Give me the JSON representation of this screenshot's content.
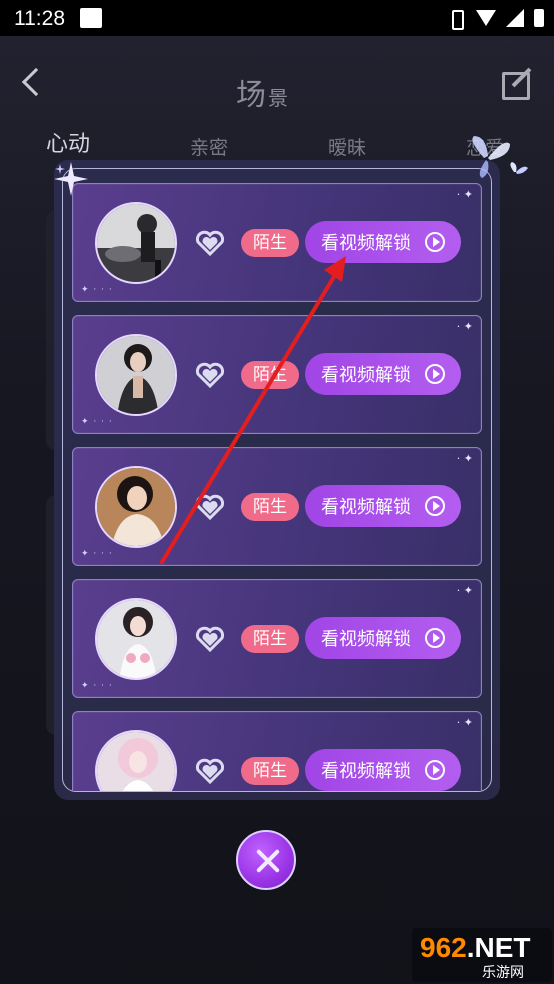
{
  "statusbar": {
    "time": "11:28"
  },
  "header": {
    "title_main": "场",
    "title_sub": "景"
  },
  "tabs": [
    {
      "label": "心动"
    },
    {
      "label": "亲密"
    },
    {
      "label": "暧昧"
    },
    {
      "label": "恋爱"
    }
  ],
  "cards": [
    {
      "badge": "陌生",
      "button": "看视频解锁"
    },
    {
      "badge": "陌生",
      "button": "看视频解锁"
    },
    {
      "badge": "陌生",
      "button": "看视频解锁"
    },
    {
      "badge": "陌生",
      "button": "看视频解锁"
    },
    {
      "badge": "陌生",
      "button": "看视频解锁"
    }
  ],
  "watermark": {
    "brand": "962",
    "suffix": ".NET",
    "site": "乐游网"
  },
  "colors": {
    "accent": "#a145e6",
    "badge": "#f06a8a",
    "card": "#4b3880",
    "arrow": "#e41e1e"
  },
  "icons": [
    "back-icon",
    "edit-icon",
    "heart-icon",
    "play-icon",
    "close-icon",
    "butterfly-icon",
    "sparkle-icon"
  ]
}
